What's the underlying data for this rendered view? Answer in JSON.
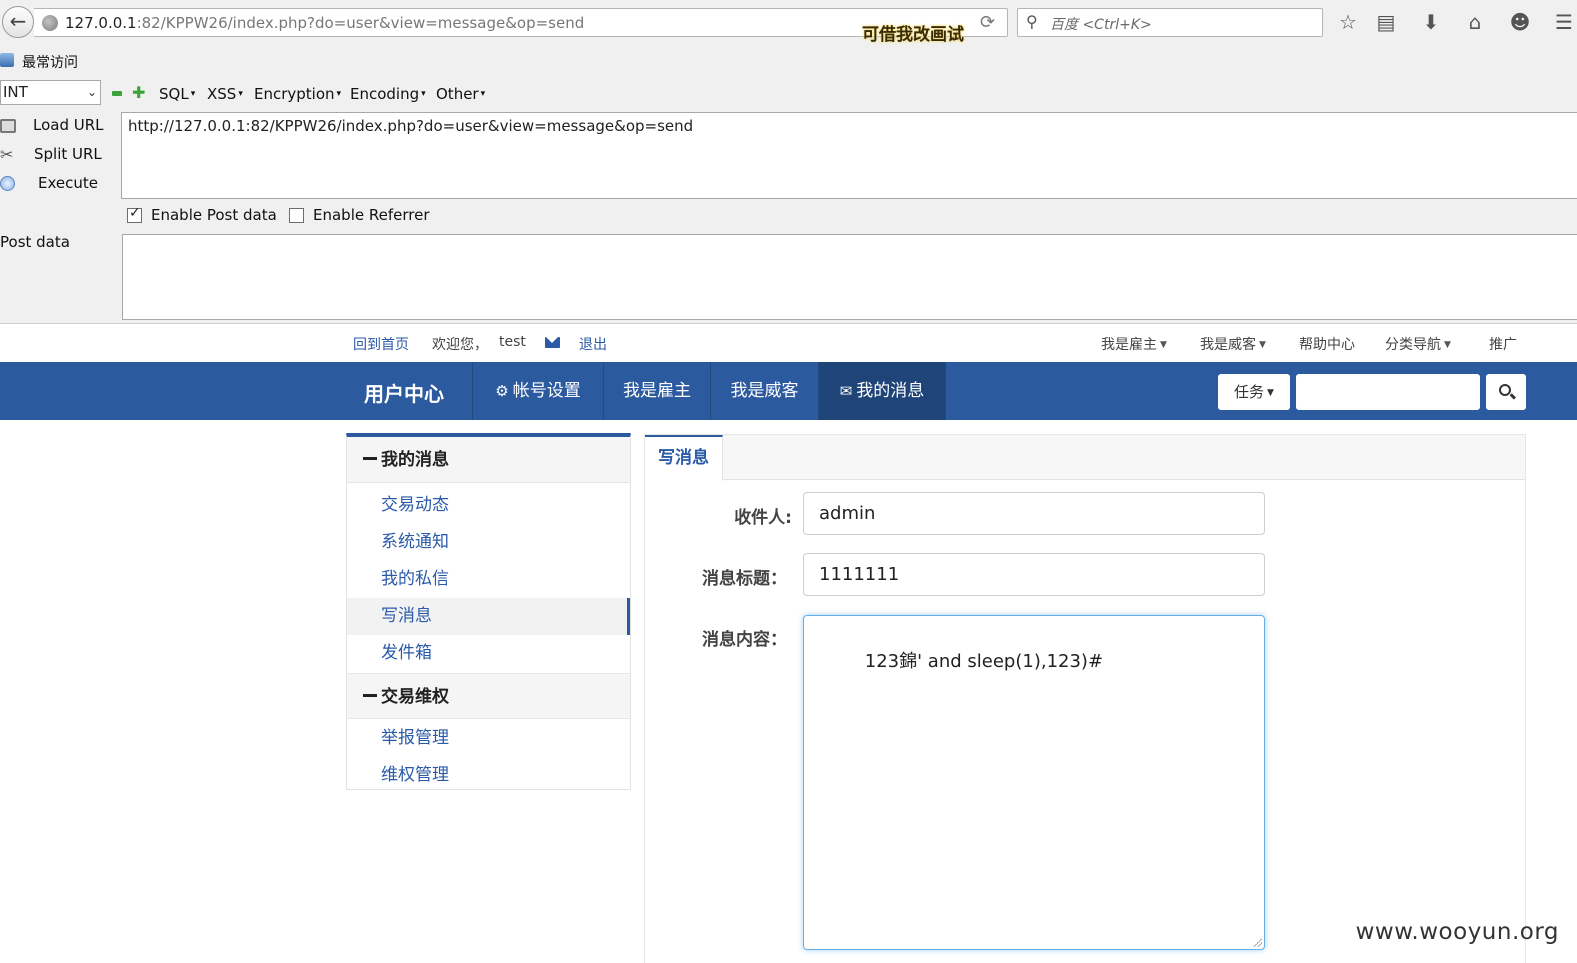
{
  "browser": {
    "url_host": "127.0.0.1",
    "url_rest": ":82/KPPW26/index.php?do=user&view=message&op=send",
    "badge": "可借我改画试",
    "search_placeholder": "百度 <Ctrl+K>",
    "bookmark_label": "最常访问"
  },
  "hackbar": {
    "select_value": "INT",
    "menus": [
      "SQL",
      "XSS",
      "Encryption",
      "Encoding",
      "Other"
    ],
    "actions": [
      "Load URL",
      "Split URL",
      "Execute"
    ],
    "url_value": "http://127.0.0.1:82/KPPW26/index.php?do=user&view=message&op=send",
    "enable_post_label": "Enable Post data",
    "enable_post_checked": true,
    "enable_referrer_label": "Enable Referrer",
    "enable_referrer_checked": false,
    "post_data_label": "Post data",
    "post_data_value": ""
  },
  "site": {
    "topbar_left": {
      "home": "回到首页",
      "welcome": "欢迎您，",
      "username": "test",
      "logout": "退出"
    },
    "topbar_right": [
      "我是雇主",
      "我是威客",
      "帮助中心",
      "分类导航",
      "推广"
    ],
    "brand": "用户中心",
    "nav": [
      "帐号设置",
      "我是雇主",
      "我是威客",
      "我的消息"
    ],
    "nav_active": "我的消息",
    "task_button": "任务",
    "search_value": ""
  },
  "sidebar": {
    "section1": "我的消息",
    "section1_items": [
      "交易动态",
      "系统通知",
      "我的私信",
      "写消息",
      "发件箱"
    ],
    "active_item": "写消息",
    "section2": "交易维权",
    "section2_items": [
      "举报管理",
      "维权管理"
    ]
  },
  "compose": {
    "tab": "写消息",
    "recipient_label": "收件人:",
    "recipient_value": "admin",
    "subject_label": "消息标题：",
    "subject_value": "1111111",
    "content_label": "消息内容：",
    "content_value": "123錦' and sleep(1),123)#"
  },
  "watermark": "www.wooyun.org"
}
